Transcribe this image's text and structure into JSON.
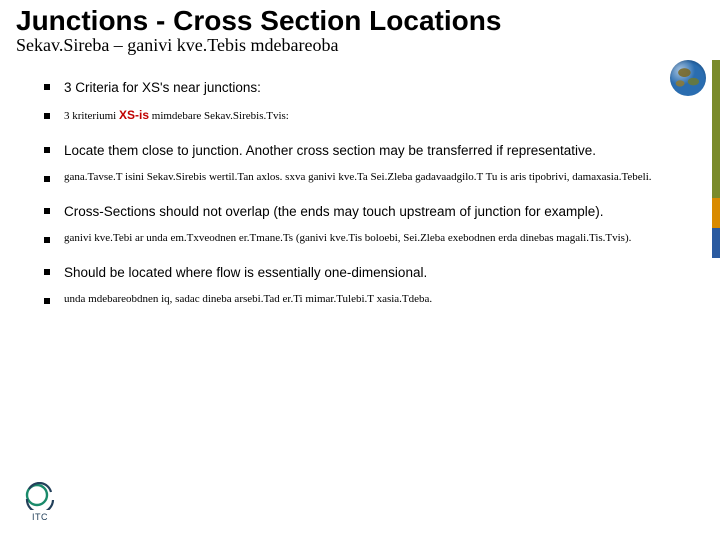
{
  "title": "Junctions - Cross Section Locations",
  "subtitle": "Sekav.Sireba – ganivi kve.Tebis mdebareoba",
  "bullets": {
    "b1": "3 Criteria for XS's near junctions:",
    "b2_pre": "3 kriteriumi ",
    "b2_xs": "XS-is",
    "b2_post": " mimdebare Sekav.Sirebis.Tvis:",
    "b3": "Locate them close to junction. Another cross section may be transferred if representative.",
    "b4": "gana.Tavse.T isini Sekav.Sirebis wertil.Tan axlos. sxva ganivi kve.Ta Sei.Zleba  gadavaadgilo.T Tu is aris tipobrivi, damaxasia.Tebeli.",
    "b5": "Cross-Sections should not overlap (the ends may touch upstream of junction for example).",
    "b6": "ganivi kve.Tebi ar unda em.Txveodnen er.Tmane.Ts (ganivi kve.Tis boloebi, Sei.Zleba exebodnen erda dinebas magali.Tis.Tvis).",
    "b7": "Should be located where flow is essentially one-dimensional.",
    "b8": "unda mdebareobdnen iq, sadac dineba arsebi.Tad er.Ti mimar.Tulebi.T xasia.Tdeba."
  },
  "icons": {
    "globe": "globe-icon",
    "logo_label": "ITC"
  },
  "colors": {
    "stripe_olive": "#7a8a2a",
    "stripe_orange": "#d98a00",
    "stripe_blue": "#2a5aa0",
    "xs_red": "#c00000"
  }
}
